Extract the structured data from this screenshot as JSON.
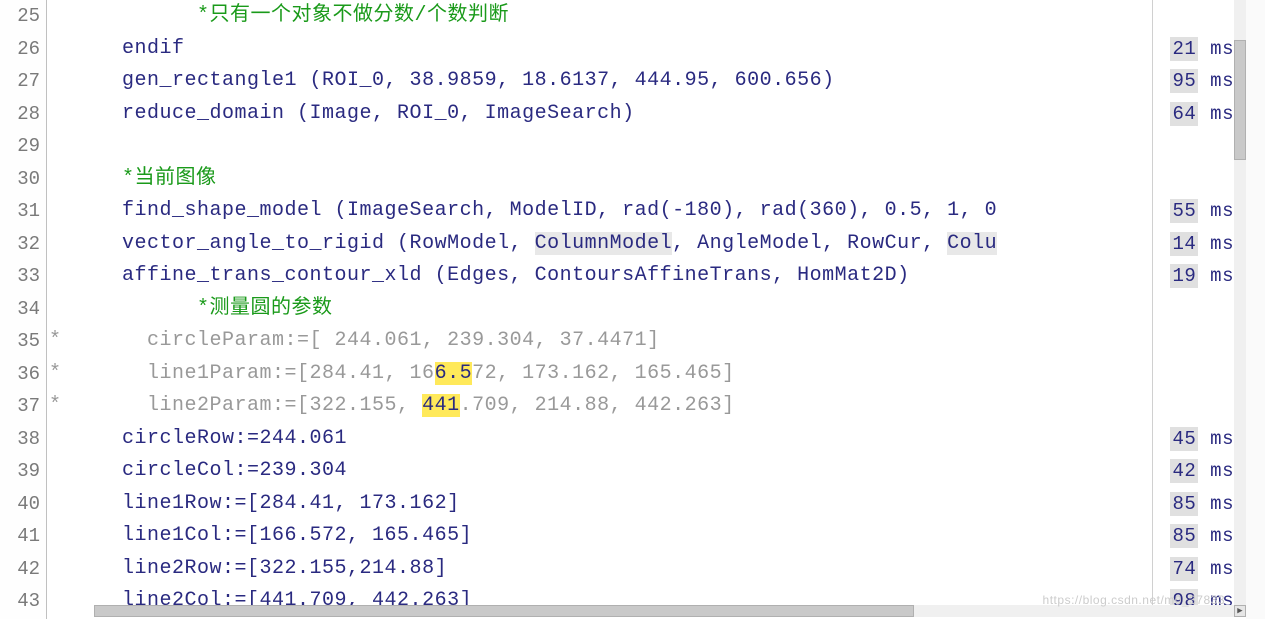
{
  "lines": [
    {
      "num": "25",
      "indent": "          ",
      "kind": "comment",
      "text": "*只有一个对象不做分数/个数判断",
      "timing": ""
    },
    {
      "num": "26",
      "indent": "    ",
      "kind": "code",
      "text": "endif",
      "timing": "21 ms"
    },
    {
      "num": "27",
      "indent": "    ",
      "kind": "code",
      "text": "gen_rectangle1 (ROI_0, 38.9859, 18.6137, 444.95, 600.656)",
      "timing": "95 ms"
    },
    {
      "num": "28",
      "indent": "    ",
      "kind": "code",
      "text": "reduce_domain (Image, ROI_0, ImageSearch)",
      "timing": "64 ms"
    },
    {
      "num": "29",
      "indent": "",
      "kind": "code",
      "text": "",
      "timing": ""
    },
    {
      "num": "30",
      "indent": "    ",
      "kind": "comment",
      "text": "*当前图像",
      "timing": ""
    },
    {
      "num": "31",
      "indent": "    ",
      "kind": "code",
      "text": "find_shape_model (ImageSearch, ModelID, rad(-180), rad(360), 0.5, 1, 0",
      "timing": "55 ms"
    },
    {
      "num": "32",
      "indent": "    ",
      "kind": "code-hl",
      "parts": [
        {
          "t": "vector_angle_to_rigid (RowModel, "
        },
        {
          "t": "ColumnModel",
          "hl": true
        },
        {
          "t": ", AngleModel, RowCur, "
        },
        {
          "t": "Colu",
          "hl": true
        }
      ],
      "timing": "14 ms"
    },
    {
      "num": "33",
      "indent": "    ",
      "kind": "code",
      "text": "affine_trans_contour_xld (Edges, ContoursAffineTrans, HomMat2D)",
      "timing": "19 ms"
    },
    {
      "num": "34",
      "indent": "          ",
      "kind": "comment",
      "text": "*测量圆的参数",
      "timing": ""
    },
    {
      "num": "35",
      "indent": "      ",
      "kind": "disabled",
      "star": "*",
      "text": "circleParam:=[ 244.061, 239.304, 37.4471]",
      "timing": ""
    },
    {
      "num": "36",
      "indent": "      ",
      "kind": "disabled-cursor",
      "star": "*",
      "before": "line1Param:=[284.41, 16",
      "cursor": "6.5",
      "cursorChar": "I",
      "after": "72, 173.162, 165.465]",
      "timing": ""
    },
    {
      "num": "37",
      "indent": "      ",
      "kind": "disabled-cursor2",
      "star": "*",
      "before": "line2Param:=[322.155, ",
      "cursor": "441",
      "after": ".709, 214.88, 442.263]",
      "timing": ""
    },
    {
      "num": "38",
      "indent": "    ",
      "kind": "code",
      "text": "circleRow:=244.061",
      "timing": "45 ms"
    },
    {
      "num": "39",
      "indent": "    ",
      "kind": "code",
      "text": "circleCol:=239.304",
      "timing": "42 ms"
    },
    {
      "num": "40",
      "indent": "    ",
      "kind": "code",
      "text": "line1Row:=[284.41, 173.162]",
      "timing": "85 ms"
    },
    {
      "num": "41",
      "indent": "    ",
      "kind": "code",
      "text": "line1Col:=[166.572, 165.465]",
      "timing": "85 ms"
    },
    {
      "num": "42",
      "indent": "    ",
      "kind": "code",
      "text": "line2Row:=[322.155,214.88]",
      "timing": "74 ms"
    },
    {
      "num": "43",
      "indent": "    ",
      "kind": "code",
      "text": "line2Col:=[441.709, 442.263]",
      "timing": "98 ms"
    }
  ],
  "watermark": "https://blog.csdn.net/m0_37833"
}
